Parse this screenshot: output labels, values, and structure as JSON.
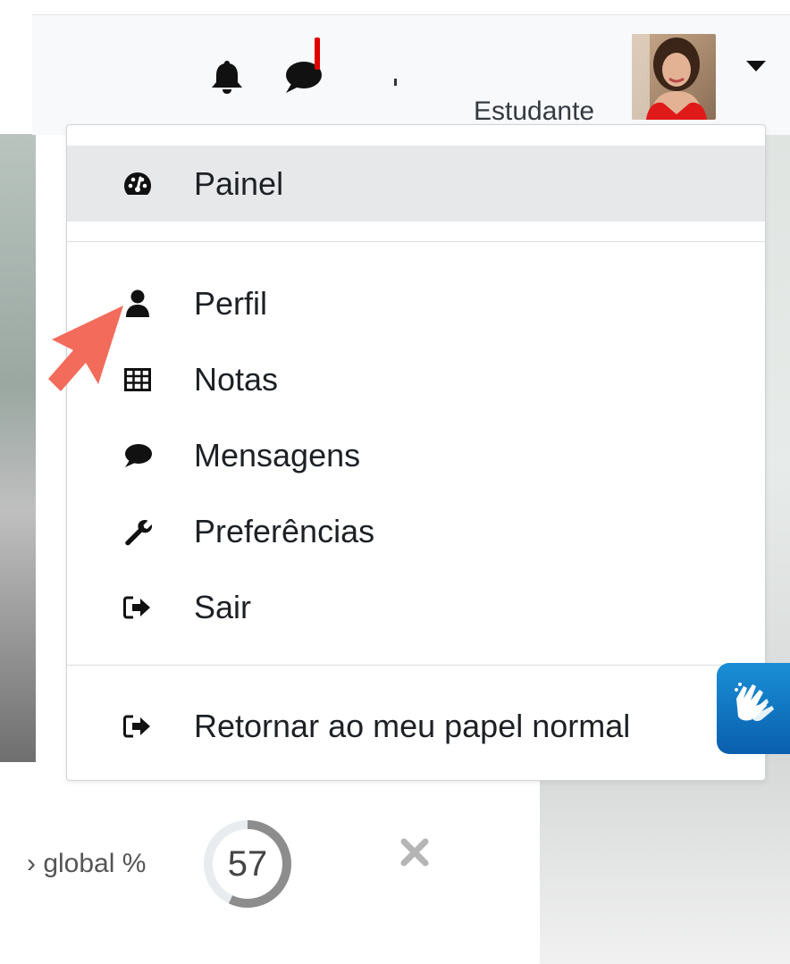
{
  "navbar": {
    "user_name": "Estudante",
    "notification_icon": "bell-icon",
    "messages_icon": "chat-icon",
    "unread_badge_color": "#e00000"
  },
  "user_menu": {
    "items": [
      {
        "label": "Painel",
        "icon": "dashboard-icon",
        "active": true
      },
      {
        "label": "Perfil",
        "icon": "user-icon"
      },
      {
        "label": "Notas",
        "icon": "table-icon"
      },
      {
        "label": "Mensagens",
        "icon": "chat-icon"
      },
      {
        "label": "Preferências",
        "icon": "wrench-icon"
      },
      {
        "label": "Sair",
        "icon": "logout-icon"
      },
      {
        "label": "Retornar ao meu papel normal",
        "icon": "logout-icon"
      }
    ]
  },
  "progress": {
    "label": "› global %",
    "value": "57",
    "percent": 57
  },
  "colors": {
    "annotation_arrow": "#f26b5b",
    "accessibility_button": "#0a6fc0",
    "active_item_bg": "#e6e8ea"
  }
}
